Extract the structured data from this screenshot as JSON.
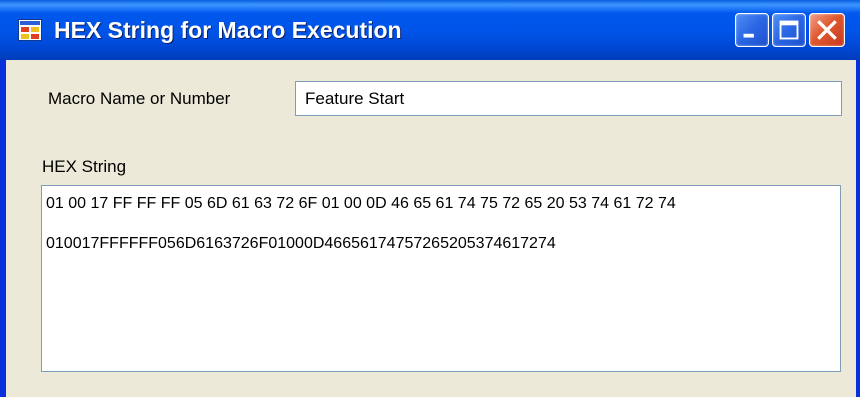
{
  "window": {
    "title": "HEX String for Macro Execution",
    "icon": "app-window-icon",
    "controls": [
      "minimize-icon",
      "maximize-icon",
      "close-icon"
    ]
  },
  "form": {
    "macro_label": "Macro Name or Number",
    "macro_value": "Feature Start",
    "hex_label": "HEX String",
    "hex_spaced": "01 00 17 FF FF FF 05 6D 61 63 72 6F 01 00 0D 46 65 61 74 75 72 65 20 53 74 61 72 74",
    "hex_compact": "010017FFFFFF056D6163726F01000D46656174757265205374617274"
  },
  "colors": {
    "title_bar": "#0054e3",
    "client_background": "#ece9d8",
    "field_border": "#7f9db9",
    "close_button": "#e0582f"
  }
}
